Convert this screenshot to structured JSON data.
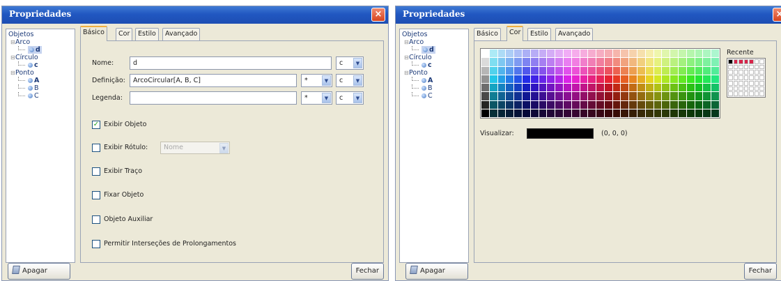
{
  "dialog1": {
    "title": "Propriedades",
    "close": "×",
    "tree": {
      "root": "Objetos",
      "groups": [
        {
          "name": "Arco",
          "items": [
            "d"
          ]
        },
        {
          "name": "Círculo",
          "items": [
            "c"
          ]
        },
        {
          "name": "Ponto",
          "items": [
            "A",
            "B",
            "C"
          ]
        }
      ]
    },
    "tabs": [
      "Básico",
      "Cor",
      "Estilo",
      "Avançado"
    ],
    "active_tab": "Básico",
    "basic": {
      "nome_label": "Nome:",
      "nome_value": "d",
      "nome_lang": "c",
      "definicao_label": "Definição:",
      "definicao_value": "ArcoCircular[A, B, C]",
      "definicao_opt": "*",
      "definicao_lang": "c",
      "legenda_label": "Legenda:",
      "legenda_value": "",
      "legenda_opt": "*",
      "legenda_lang": "c"
    },
    "checkboxes": [
      {
        "label": "Exibir Objeto",
        "checked": true
      },
      {
        "label": "Exibir Rótulo:",
        "checked": false,
        "dropdown": "Nome"
      },
      {
        "label": "Exibir Traço",
        "checked": false
      },
      {
        "label": "Fixar Objeto",
        "checked": false
      },
      {
        "label": "Objeto Auxiliar",
        "checked": false
      },
      {
        "label": "Permitir Interseções de Prolongamentos",
        "checked": false
      }
    ],
    "delete_button": "Apagar",
    "close_button": "Fechar"
  },
  "dialog2": {
    "title": "Propriedades",
    "close": "×",
    "tree": {
      "root": "Objetos",
      "groups": [
        {
          "name": "Arco",
          "items": [
            "d"
          ]
        },
        {
          "name": "Círculo",
          "items": [
            "c"
          ]
        },
        {
          "name": "Ponto",
          "items": [
            "A",
            "B",
            "C"
          ]
        }
      ]
    },
    "tabs": [
      "Básico",
      "Cor",
      "Estilo",
      "Avançado"
    ],
    "active_tab": "Cor",
    "color": {
      "recent_label": "Recente",
      "recent_colors": [
        "#000000",
        "#d8244a",
        "#d8244a",
        "#d8244a",
        "#d8244a"
      ],
      "preview_label": "Visualizar:",
      "preview_color": "#000000",
      "rgb_value": "(0, 0, 0)"
    },
    "delete_button": "Apagar",
    "close_button": "Fechar"
  }
}
